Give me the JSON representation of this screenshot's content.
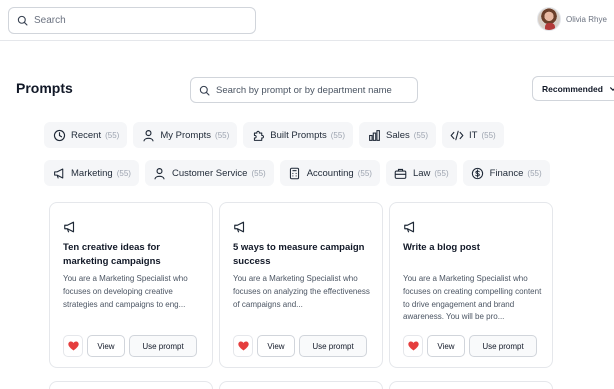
{
  "topbar": {
    "search_placeholder": "Search",
    "user_name": "Olivia Rhye"
  },
  "page": {
    "title": "Prompts",
    "search_placeholder": "Search by prompt or by department name",
    "sort_label": "Recommended"
  },
  "categories_row1": [
    {
      "label": "Recent",
      "count": "(55)",
      "icon": "clock-icon"
    },
    {
      "label": "My Prompts",
      "count": "(55)",
      "icon": "user-icon"
    },
    {
      "label": "Built Prompts",
      "count": "(55)",
      "icon": "puzzle-icon"
    },
    {
      "label": "Sales",
      "count": "(55)",
      "icon": "bar-chart-icon"
    },
    {
      "label": "IT",
      "count": "(55)",
      "icon": "code-icon"
    }
  ],
  "categories_row2": [
    {
      "label": "Marketing",
      "count": "(55)",
      "icon": "megaphone-icon"
    },
    {
      "label": "Customer Service",
      "count": "(55)",
      "icon": "user-icon"
    },
    {
      "label": "Accounting",
      "count": "(55)",
      "icon": "calculator-icon"
    },
    {
      "label": "Law",
      "count": "(55)",
      "icon": "briefcase-icon"
    },
    {
      "label": "Finance",
      "count": "(55)",
      "icon": "dollar-icon"
    }
  ],
  "cards": [
    {
      "title": "Ten creative ideas for marketing campaigns",
      "description": "You are a Marketing Specialist who focuses on developing creative strategies and campaigns to eng...",
      "view_label": "View",
      "use_label": "Use prompt"
    },
    {
      "title": "5 ways to measure campaign success",
      "description": "You are a Marketing Specialist who focuses on analyzing the effectiveness of campaigns and...",
      "view_label": "View",
      "use_label": "Use prompt"
    },
    {
      "title": "Write a blog post",
      "description": "You are a Marketing Specialist who focuses on creating compelling content to drive engagement and brand awareness. You will be pro...",
      "view_label": "View",
      "use_label": "Use prompt"
    }
  ],
  "colors": {
    "favorite": "#e53e3e",
    "chip_bg": "#f5f6f8",
    "border": "#e5e7eb"
  }
}
